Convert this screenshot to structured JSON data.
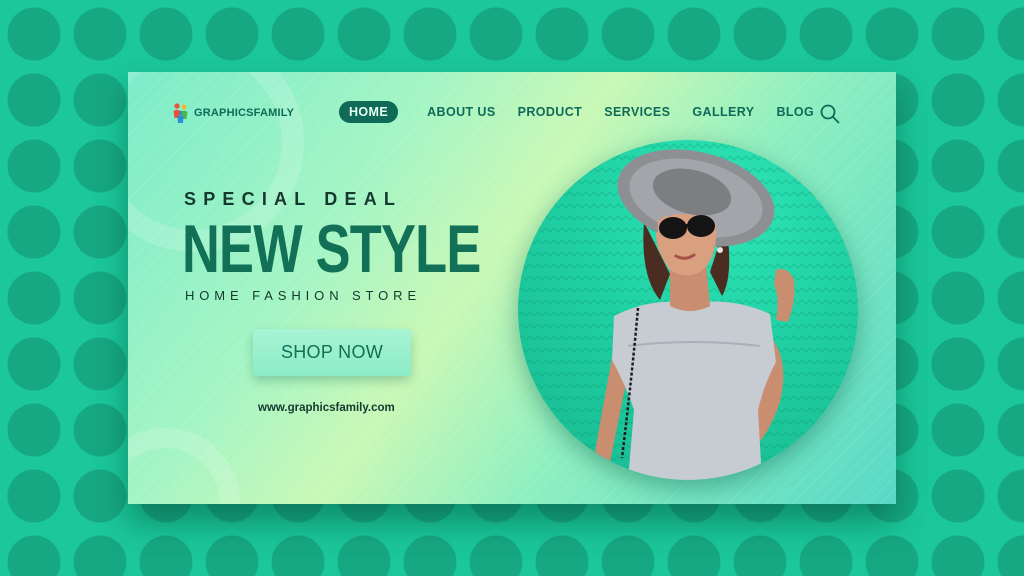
{
  "brand": {
    "name": "GRAPHICSFAMILY",
    "website": "www.graphicsfamily.com"
  },
  "nav": {
    "items": [
      {
        "label": "HOME",
        "active": true
      },
      {
        "label": "ABOUT US",
        "active": false
      },
      {
        "label": "PRODUCT",
        "active": false
      },
      {
        "label": "SERVICES",
        "active": false
      },
      {
        "label": "GALLERY",
        "active": false
      },
      {
        "label": "BLOG",
        "active": false
      }
    ],
    "search_icon": "search-icon"
  },
  "hero": {
    "kicker": "SPECIAL DEAL",
    "title": "NEW STYLE",
    "subtitle": "HOME FASHION STORE",
    "cta_label": "SHOP NOW"
  },
  "colors": {
    "background": "#1bc79b",
    "background_dots": "#16a883",
    "accent_dark": "#117056",
    "nav_active_bg": "#0f6b57",
    "text_dark": "#14392f",
    "circle_green": "#1fcfa2"
  }
}
